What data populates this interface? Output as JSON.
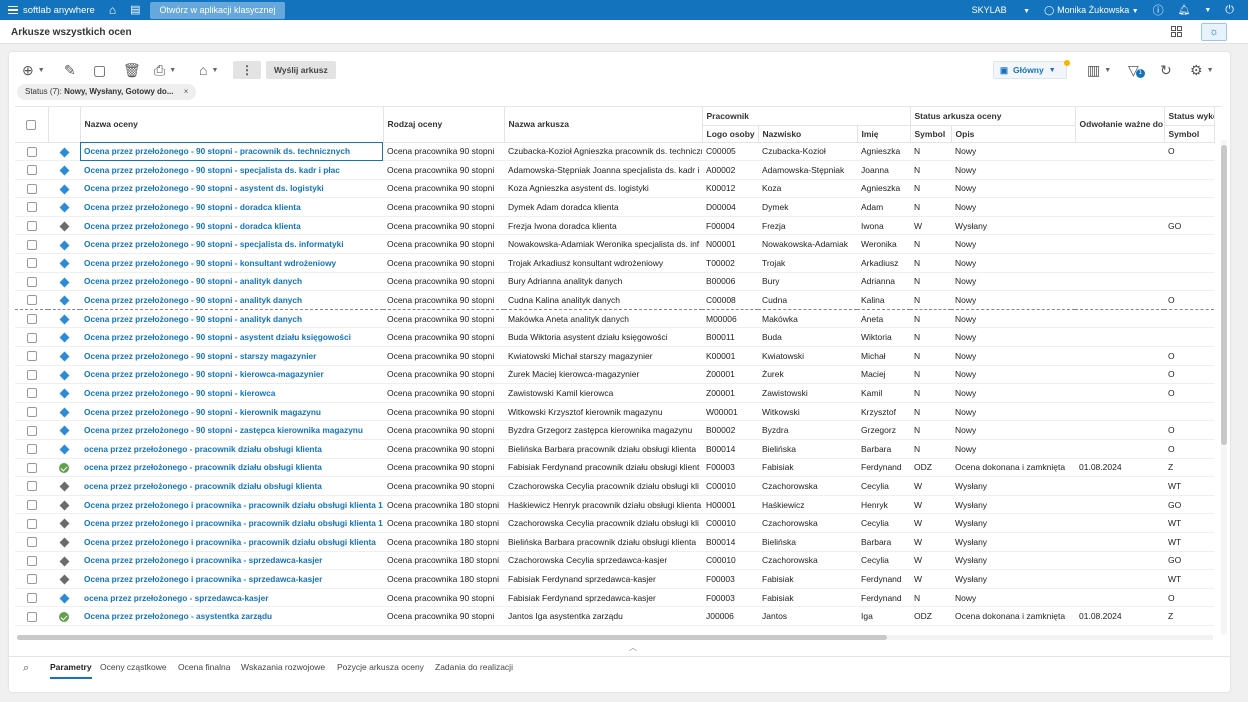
{
  "topbar": {
    "brand": "softlab anywhere",
    "open_classic": "Otwórz w aplikacji klasycznej",
    "company": "SKYLAB",
    "user": "Monika Żukowska"
  },
  "page": {
    "title": "Arkusze wszystkich ocen"
  },
  "toolbar": {
    "send_sheet": "Wyślij arkusz",
    "view_name": "Główny",
    "filter_count": "1"
  },
  "filter_chip": {
    "label": "Status (7):",
    "value": "Nowy, Wysłany, Gotowy do...",
    "close": "×"
  },
  "grid": {
    "headers": {
      "name": "Nazwa oceny",
      "type": "Rodzaj oceny",
      "sheet": "Nazwa arkusza",
      "employee": "Pracownik",
      "logo": "Logo osoby",
      "surname": "Nazwisko",
      "firstname": "Imię",
      "sheet_status": "Status arkusza oceny",
      "symbol": "Symbol",
      "desc": "Opis",
      "revoke": "Odwołanie ważne do",
      "exec_status": "Status wyko",
      "exec_symbol": "Symbol"
    },
    "rows": [
      {
        "icon": "blue",
        "name": "Ocena przez przełożonego - 90 stopni - pracownik ds. technicznych",
        "type": "Ocena pracownika 90 stopni",
        "sheet": "Czubacka-Kozioł Agnieszka pracownik ds. techniczn",
        "logo": "C00005",
        "surname": "Czubacka-Kozioł",
        "firstname": "Agnieszka",
        "sym": "N",
        "desc": "Nowy",
        "revoke": "",
        "exec": "O"
      },
      {
        "icon": "blue",
        "name": "Ocena przez przełożonego - 90 stopni - specjalista ds. kadr i płac",
        "type": "Ocena pracownika 90 stopni",
        "sheet": "Adamowska-Stępniak Joanna specjalista ds. kadr i",
        "logo": "A00002",
        "surname": "Adamowska-Stępniak",
        "firstname": "Joanna",
        "sym": "N",
        "desc": "Nowy",
        "revoke": "",
        "exec": ""
      },
      {
        "icon": "blue",
        "name": "Ocena przez przełożonego - 90 stopni - asystent ds. logistyki",
        "type": "Ocena pracownika 90 stopni",
        "sheet": "Koza Agnieszka asystent ds. logistyki",
        "logo": "K00012",
        "surname": "Koza",
        "firstname": "Agnieszka",
        "sym": "N",
        "desc": "Nowy",
        "revoke": "",
        "exec": ""
      },
      {
        "icon": "blue",
        "name": "Ocena przez przełożonego - 90 stopni - doradca klienta",
        "type": "Ocena pracownika 90 stopni",
        "sheet": "Dymek Adam doradca klienta",
        "logo": "D00004",
        "surname": "Dymek",
        "firstname": "Adam",
        "sym": "N",
        "desc": "Nowy",
        "revoke": "",
        "exec": ""
      },
      {
        "icon": "gray",
        "name": "Ocena przez przełożonego - 90 stopni - doradca klienta",
        "type": "Ocena pracownika 90 stopni",
        "sheet": "Frezja Iwona doradca klienta",
        "logo": "F00004",
        "surname": "Frezja",
        "firstname": "Iwona",
        "sym": "W",
        "desc": "Wysłany",
        "revoke": "",
        "exec": "GO"
      },
      {
        "icon": "blue",
        "name": "Ocena przez przełożonego - 90 stopni - specjalista ds. informatyki",
        "type": "Ocena pracownika 90 stopni",
        "sheet": "Nowakowska-Adamiak Weronika specjalista ds. inf",
        "logo": "N00001",
        "surname": "Nowakowska-Adamiak",
        "firstname": "Weronika",
        "sym": "N",
        "desc": "Nowy",
        "revoke": "",
        "exec": ""
      },
      {
        "icon": "blue",
        "name": "Ocena przez przełożonego - 90 stopni - konsultant wdrożeniowy",
        "type": "Ocena pracownika 90 stopni",
        "sheet": "Trojak Arkadiusz konsultant wdrożeniowy",
        "logo": "T00002",
        "surname": "Trojak",
        "firstname": "Arkadiusz",
        "sym": "N",
        "desc": "Nowy",
        "revoke": "",
        "exec": ""
      },
      {
        "icon": "blue",
        "name": "Ocena przez przełożonego - 90 stopni - analityk danych",
        "type": "Ocena pracownika 90 stopni",
        "sheet": "Bury Adrianna analityk danych",
        "logo": "B00006",
        "surname": "Bury",
        "firstname": "Adrianna",
        "sym": "N",
        "desc": "Nowy",
        "revoke": "",
        "exec": ""
      },
      {
        "icon": "blue",
        "name": "Ocena przez przełożonego - 90 stopni - analityk danych",
        "type": "Ocena pracownika 90 stopni",
        "sheet": "Cudna Kalina analityk danych",
        "logo": "C00008",
        "surname": "Cudna",
        "firstname": "Kalina",
        "sym": "N",
        "desc": "Nowy",
        "revoke": "",
        "exec": "O"
      },
      {
        "icon": "blue",
        "name": "Ocena przez przełożonego - 90 stopni - analityk danych",
        "type": "Ocena pracownika 90 stopni",
        "sheet": "Makówka Aneta analityk danych",
        "logo": "M00006",
        "surname": "Makówka",
        "firstname": "Aneta",
        "sym": "N",
        "desc": "Nowy",
        "revoke": "",
        "exec": ""
      },
      {
        "icon": "blue",
        "name": "Ocena przez przełożonego - 90 stopni - asystent działu księgowości",
        "type": "Ocena pracownika 90 stopni",
        "sheet": "Buda Wiktoria asystent działu księgowości",
        "logo": "B00011",
        "surname": "Buda",
        "firstname": "Wiktoria",
        "sym": "N",
        "desc": "Nowy",
        "revoke": "",
        "exec": ""
      },
      {
        "icon": "blue",
        "name": "Ocena przez przełożonego - 90 stopni - starszy magazynier",
        "type": "Ocena pracownika 90 stopni",
        "sheet": "Kwiatowski Michał starszy magazynier",
        "logo": "K00001",
        "surname": "Kwiatowski",
        "firstname": "Michał",
        "sym": "N",
        "desc": "Nowy",
        "revoke": "",
        "exec": "O"
      },
      {
        "icon": "blue",
        "name": "Ocena przez przełożonego - 90 stopni - kierowca-magazynier",
        "type": "Ocena pracownika 90 stopni",
        "sheet": "Żurek Maciej kierowca-magazynier",
        "logo": "Ż00001",
        "surname": "Żurek",
        "firstname": "Maciej",
        "sym": "N",
        "desc": "Nowy",
        "revoke": "",
        "exec": "O"
      },
      {
        "icon": "blue",
        "name": "Ocena przez przełożonego - 90 stopni - kierowca",
        "type": "Ocena pracownika 90 stopni",
        "sheet": "Zawistowski Kamil kierowca",
        "logo": "Z00001",
        "surname": "Zawistowski",
        "firstname": "Kamil",
        "sym": "N",
        "desc": "Nowy",
        "revoke": "",
        "exec": "O"
      },
      {
        "icon": "blue",
        "name": "Ocena przez przełożonego - 90 stopni - kierownik magazynu",
        "type": "Ocena pracownika 90 stopni",
        "sheet": "Witkowski Krzysztof kierownik magazynu",
        "logo": "W00001",
        "surname": "Witkowski",
        "firstname": "Krzysztof",
        "sym": "N",
        "desc": "Nowy",
        "revoke": "",
        "exec": ""
      },
      {
        "icon": "blue",
        "name": "Ocena przez przełożonego - 90 stopni - zastępca kierownika magazynu",
        "type": "Ocena pracownika 90 stopni",
        "sheet": "Byzdra Grzegorz zastępca kierownika magazynu",
        "logo": "B00002",
        "surname": "Byzdra",
        "firstname": "Grzegorz",
        "sym": "N",
        "desc": "Nowy",
        "revoke": "",
        "exec": "O"
      },
      {
        "icon": "blue",
        "name": "ocena przez przełożonego - pracownik działu obsługi klienta",
        "type": "Ocena pracownika 90 stopni",
        "sheet": "Bielińska Barbara pracownik działu obsługi klienta",
        "logo": "B00014",
        "surname": "Bielińska",
        "firstname": "Barbara",
        "sym": "N",
        "desc": "Nowy",
        "revoke": "",
        "exec": "O"
      },
      {
        "icon": "ok",
        "name": "ocena przez przełożonego - pracownik działu obsługi klienta",
        "type": "Ocena pracownika 90 stopni",
        "sheet": "Fabisiak Ferdynand pracownik działu obsługi klient",
        "logo": "F00003",
        "surname": "Fabisiak",
        "firstname": "Ferdynand",
        "sym": "ODZ",
        "desc": "Ocena dokonana i zamknięta",
        "revoke": "01.08.2024",
        "exec": "Z"
      },
      {
        "icon": "gray",
        "name": "ocena przez przełożonego - pracownik działu obsługi klienta",
        "type": "Ocena pracownika 90 stopni",
        "sheet": "Czachorowska Cecylia pracownik działu obsługi kli",
        "logo": "C00010",
        "surname": "Czachorowska",
        "firstname": "Cecylia",
        "sym": "W",
        "desc": "Wysłany",
        "revoke": "",
        "exec": "WT"
      },
      {
        "icon": "gray",
        "name": "Ocena przez przełożonego i pracownika - pracownik działu obsługi klienta 1",
        "type": "Ocena pracownika 180 stopni",
        "sheet": "Haśkiewicz Henryk pracownik działu obsługi klienta",
        "logo": "H00001",
        "surname": "Haśkiewicz",
        "firstname": "Henryk",
        "sym": "W",
        "desc": "Wysłany",
        "revoke": "",
        "exec": "GO"
      },
      {
        "icon": "gray",
        "name": "Ocena przez przełożonego i pracownika - pracownik działu obsługi klienta 1",
        "type": "Ocena pracownika 180 stopni",
        "sheet": "Czachorowska Cecylia pracownik działu obsługi kli",
        "logo": "C00010",
        "surname": "Czachorowska",
        "firstname": "Cecylia",
        "sym": "W",
        "desc": "Wysłany",
        "revoke": "",
        "exec": "WT"
      },
      {
        "icon": "gray",
        "name": "Ocena przez przełożonego i pracownika - pracownik działu obsługi klienta",
        "type": "Ocena pracownika 180 stopni",
        "sheet": "Bielińska Barbara pracownik działu obsługi klienta",
        "logo": "B00014",
        "surname": "Bielińska",
        "firstname": "Barbara",
        "sym": "W",
        "desc": "Wysłany",
        "revoke": "",
        "exec": "WT"
      },
      {
        "icon": "gray",
        "name": "Ocena przez przełożonego i pracownika - sprzedawca-kasjer",
        "type": "Ocena pracownika 180 stopni",
        "sheet": "Czachorowska Cecylia sprzedawca-kasjer",
        "logo": "C00010",
        "surname": "Czachorowska",
        "firstname": "Cecylia",
        "sym": "W",
        "desc": "Wysłany",
        "revoke": "",
        "exec": "GO"
      },
      {
        "icon": "gray",
        "name": "Ocena przez przełożonego i pracownika - sprzedawca-kasjer",
        "type": "Ocena pracownika 180 stopni",
        "sheet": "Fabisiak Ferdynand sprzedawca-kasjer",
        "logo": "F00003",
        "surname": "Fabisiak",
        "firstname": "Ferdynand",
        "sym": "W",
        "desc": "Wysłany",
        "revoke": "",
        "exec": "WT"
      },
      {
        "icon": "blue",
        "name": "ocena przez przełożonego - sprzedawca-kasjer",
        "type": "Ocena pracownika 90 stopni",
        "sheet": "Fabisiak Ferdynand sprzedawca-kasjer",
        "logo": "F00003",
        "surname": "Fabisiak",
        "firstname": "Ferdynand",
        "sym": "N",
        "desc": "Nowy",
        "revoke": "",
        "exec": "O"
      },
      {
        "icon": "ok",
        "name": "Ocena przez przełożonego - asystentka zarządu",
        "type": "Ocena pracownika 90 stopni",
        "sheet": "Jantos Iga asystentka zarządu",
        "logo": "J00006",
        "surname": "Jantos",
        "firstname": "Iga",
        "sym": "ODZ",
        "desc": "Ocena dokonana i zamknięta",
        "revoke": "01.08.2024",
        "exec": "Z"
      }
    ]
  },
  "tabs": [
    "Parametry",
    "Oceny cząstkowe",
    "Ocena finalna",
    "Wskazania rozwojowe",
    "Pozycje arkusza oceny",
    "Zadania do realizacji"
  ],
  "colors": {
    "brand": "#1473bd",
    "status_new": "#2d8ad6",
    "status_sent": "#6b6b6b",
    "status_closed": "#62a04e"
  }
}
